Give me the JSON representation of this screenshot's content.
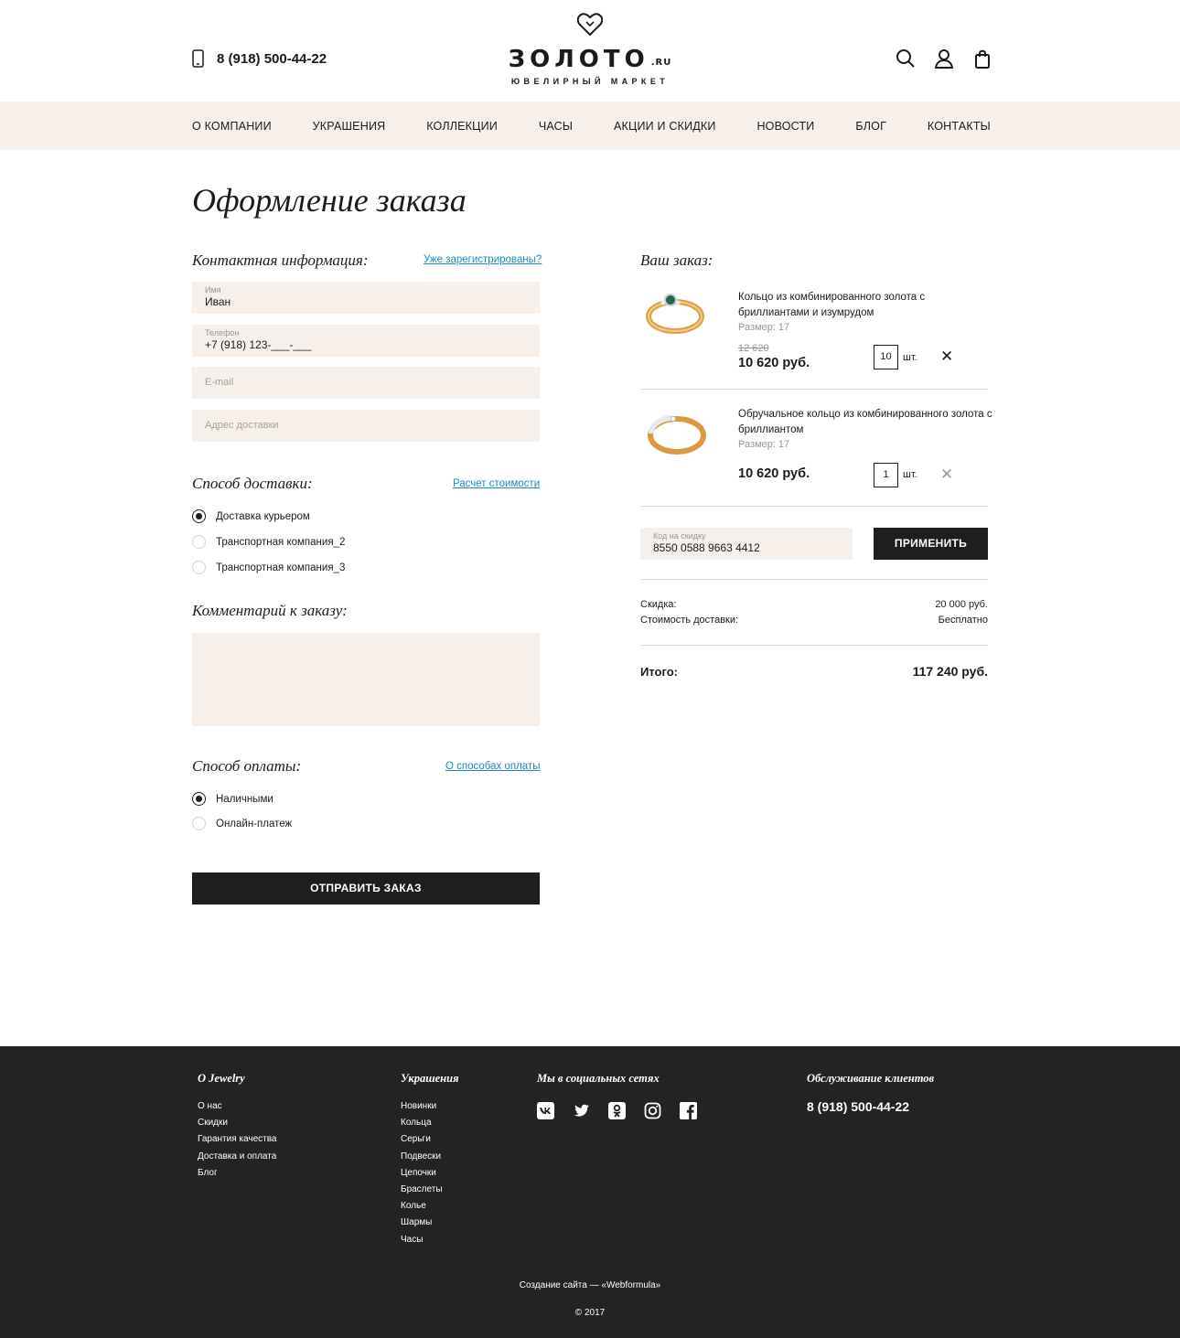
{
  "header": {
    "phone": "8 (918) 500-44-22",
    "logo_word": "ЗОЛОТО",
    "logo_tld": ".RU",
    "logo_tagline": "ЮВЕЛИРНЫЙ МАРКЕТ",
    "icons": [
      "search-icon",
      "user-icon",
      "bag-icon"
    ]
  },
  "nav": {
    "items": [
      {
        "label": "О КОМПАНИИ"
      },
      {
        "label": "УКРАШЕНИЯ"
      },
      {
        "label": "КОЛЛЕКЦИИ"
      },
      {
        "label": "ЧАСЫ"
      },
      {
        "label": "АКЦИИ И СКИДКИ"
      },
      {
        "label": "НОВОСТИ"
      },
      {
        "label": "БЛОГ"
      },
      {
        "label": "КОНТАКТЫ"
      }
    ]
  },
  "page_title": "Оформление заказа",
  "contact": {
    "title": "Контактная информация:",
    "login_link": "Уже зарегистрированы?",
    "name": {
      "label": "Имя",
      "value": "Иван"
    },
    "phone": {
      "label": "Телефон",
      "value": "+7 (918) 123-___-___"
    },
    "email": {
      "placeholder": "E-mail"
    },
    "address": {
      "placeholder": "Адрес доставки"
    }
  },
  "delivery": {
    "title": "Способ доставки:",
    "link": "Расчет стоимости",
    "options": [
      {
        "label": "Доставка курьером",
        "selected": true
      },
      {
        "label": "Транспортная компания_2",
        "selected": false
      },
      {
        "label": "Транспортная компания_3",
        "selected": false
      }
    ]
  },
  "comment": {
    "title": "Комментарий к заказу:",
    "value": ""
  },
  "payment": {
    "title": "Способ оплаты:",
    "link": "О способах оплаты",
    "options": [
      {
        "label": "Наличными",
        "selected": true
      },
      {
        "label": "Онлайн-платеж",
        "selected": false
      }
    ]
  },
  "submit_label": "ОТПРАВИТЬ ЗАКАЗ",
  "order": {
    "title": "Ваш заказ:",
    "items": [
      {
        "name": "Кольцо из комбинированного золота с бриллиантами и изумрудом",
        "size": "Размер: 17",
        "old_price": "12 620",
        "price": "10 620 руб.",
        "qty": "10",
        "unit": "шт."
      },
      {
        "name": "Обручальное кольцо из комбинированного золота с бриллиантом",
        "size": "Размер: 17",
        "old_price": "",
        "price": "10 620 руб.",
        "qty": "1",
        "unit": "шт."
      }
    ],
    "promo": {
      "label": "Код на скидку",
      "value": "8550 0588 9663 4412"
    },
    "apply_label": "ПРИМЕНИТЬ",
    "discount_label": "Скидка:",
    "discount_value": "20 000 руб.",
    "shipping_label": "Стоимость доставки:",
    "shipping_value": "Бесплатно",
    "total_label": "Итого:",
    "total_value": "117 240 руб."
  },
  "footer": {
    "about_title": "О Jewelry",
    "about_links": [
      "О нас",
      "Скидки",
      "Гарантия качества",
      "Доставка и оплата",
      "Блог"
    ],
    "jewelry_title": "Украшения",
    "jewelry_links": [
      "Новинки",
      "Кольца",
      "Серьги",
      "Подвески",
      "Цепочки",
      "Браслеты",
      "Колье",
      "Шармы",
      "Часы"
    ],
    "social_title": "Мы в социальных сетях",
    "social_icons": [
      "vk-icon",
      "twitter-icon",
      "odnoklassniki-icon",
      "instagram-icon",
      "facebook-icon"
    ],
    "service_title": "Обслуживание клиентов",
    "service_phone": "8 (918) 500-44-22",
    "credit": "Создание сайта — «Webformula»",
    "copyright": "© 2017"
  },
  "colors": {
    "beige": "#f6efea",
    "dark": "#1e1e1e",
    "link": "#1f86c7",
    "footer_bg": "#232323"
  }
}
